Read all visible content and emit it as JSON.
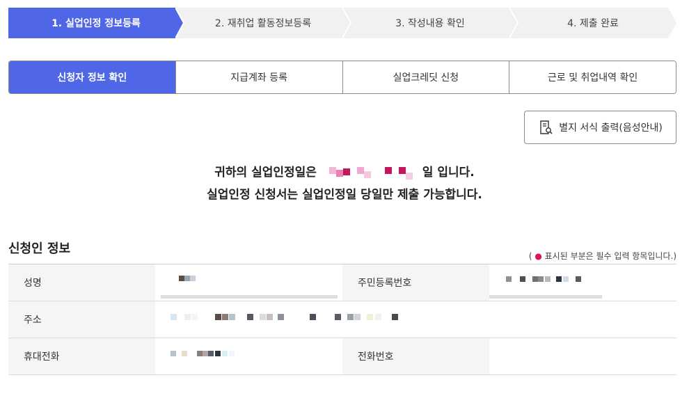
{
  "steps": [
    {
      "label": "1. 실업인정 정보등록",
      "active": true
    },
    {
      "label": "2. 재취업 활동정보등록",
      "active": false
    },
    {
      "label": "3. 작성내용 확인",
      "active": false
    },
    {
      "label": "4. 제출 완료",
      "active": false
    }
  ],
  "tabs": [
    {
      "label": "신청자 정보 확인",
      "active": true
    },
    {
      "label": "지급계좌 등록",
      "active": false
    },
    {
      "label": "실업크레딧 신청",
      "active": false
    },
    {
      "label": "근로 및 취업내역 확인",
      "active": false
    }
  ],
  "print_button": {
    "label": "별지 서식 출력(음성안내)",
    "icon": "document-search-icon"
  },
  "notice": {
    "line1_prefix": "귀하의 실업인정일은",
    "line1_suffix": "일 입니다.",
    "line2": "실업인정 신청서는 실업인정일 당일만 제출 가능합니다."
  },
  "section": {
    "title": "신청인 정보",
    "required_note_open": "(",
    "required_note_dot": "●",
    "required_note_text": "표시된 부분은 필수 입력 항목입니다.)"
  },
  "fields": {
    "name_label": "성명",
    "rrn_label": "주민등록번호",
    "address_label": "주소",
    "mobile_label": "휴대전화",
    "phone_label": "전화번호"
  },
  "colors": {
    "accent": "#4f67e6",
    "step_inactive": "#f1f1f1",
    "required_dot": "#d6175c"
  }
}
